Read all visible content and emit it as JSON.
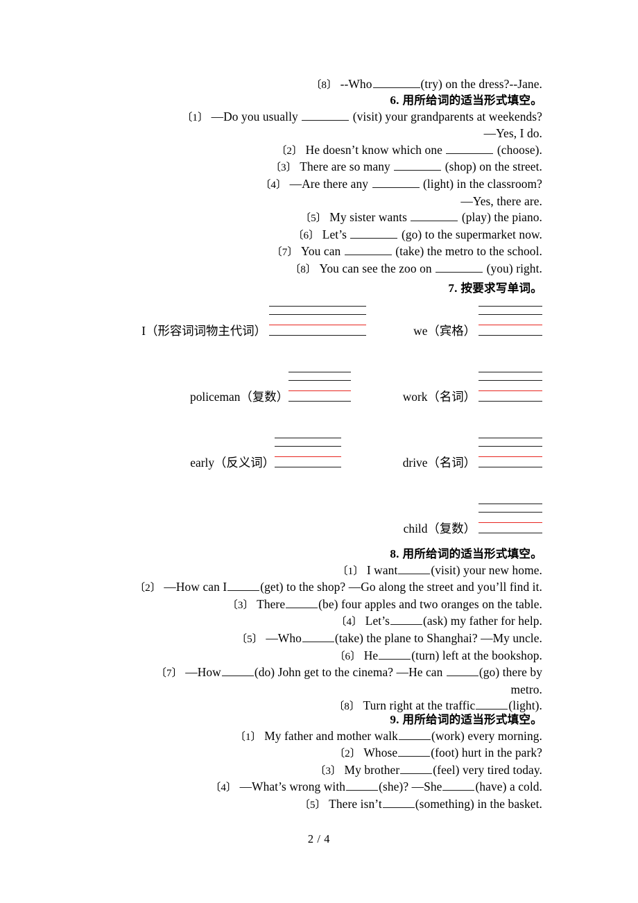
{
  "document": {
    "page_label": "2 / 4"
  },
  "exercises": [
    {
      "id": "q5-tail",
      "items": [
        {
          "num": "〔8〕",
          "before": "--Who",
          "blank": "w8",
          "after": "(try) on the dress?--Jane."
        }
      ]
    },
    {
      "id": "section-6",
      "heading_number": "6.",
      "heading_text": "用所给词的适当形式填空。",
      "lines": [
        {
          "num": "〔1〕",
          "before": "—Do you usually",
          "blank": "w8",
          "after": "(visit) your grandparents at weekends?"
        },
        {
          "num": "",
          "before": "",
          "blank": "",
          "after": "—Yes, I do."
        },
        {
          "num": "〔2〕",
          "before": "He doesn’t know which one",
          "blank": "w8",
          "after": "(choose)."
        },
        {
          "num": "〔3〕",
          "before": "There are so many",
          "blank": "w8",
          "after": "(shop) on the street."
        },
        {
          "num": "〔4〕",
          "before": "—Are there any",
          "blank": "w8",
          "after": "(light) in the classroom?"
        },
        {
          "num": "",
          "before": "",
          "blank": "",
          "after": "—Yes, there are."
        },
        {
          "num": "〔5〕",
          "before": "My sister wants",
          "blank": "w8",
          "after": "(play) the piano."
        },
        {
          "num": "〔6〕",
          "before": "Let’s",
          "blank": "w8",
          "after": "(go) to the supermarket now."
        },
        {
          "num": "〔7〕",
          "before": "You can",
          "blank": "w8",
          "after": "(take) the metro to the school."
        },
        {
          "num": "〔8〕",
          "before": "You can see the zoo on",
          "blank": "w8",
          "after": "(you) right."
        }
      ]
    },
    {
      "id": "section-7",
      "heading_number": "7.",
      "heading_text": "按要求写单词。",
      "word_rows": [
        {
          "left": "I（形容词词物主代词）",
          "right": "we（宾格）"
        },
        {
          "left": "policeman（复数）",
          "right": "work（名词）"
        },
        {
          "left": "early（反义词）",
          "right": "drive（名词）"
        },
        {
          "left": "",
          "right": "child（复数）"
        }
      ]
    },
    {
      "id": "section-8",
      "heading_number": "8.",
      "heading_text": "用所给词的适当形式填空。",
      "lines": [
        {
          "num": "〔1〕",
          "before": "I want",
          "blank": "w6",
          "after": "(visit) your new home."
        },
        {
          "num": "〔2〕",
          "before": "—How can I",
          "blank": "w6",
          "after": "(get) to the shop? —Go along the street and you’ll find it."
        },
        {
          "num": "〔3〕",
          "before": "There",
          "blank": "w6",
          "after": "(be) four apples and two oranges on the table."
        },
        {
          "num": "〔4〕",
          "before": "Let’s",
          "blank": "w6",
          "after": "(ask) my father for help."
        },
        {
          "num": "〔5〕",
          "before": "—Who",
          "blank": "w6",
          "after": "(take) the plane to Shanghai? —My uncle."
        },
        {
          "num": "〔6〕",
          "before": "He",
          "blank": "w6",
          "after": "(turn) left at the bookshop."
        },
        {
          "num": "〔7〕",
          "before": "—How",
          "blank": "w6",
          "after": "(do) John get to the cinema? —He can",
          "blank2": "w6",
          "after2": "(go) there by"
        },
        {
          "num": "",
          "before": "",
          "blank": "",
          "after": "metro."
        },
        {
          "num": "〔8〕",
          "before": "Turn right at the traffic",
          "blank": "w6",
          "after": "(light)."
        }
      ]
    },
    {
      "id": "section-9",
      "heading_number": "9.",
      "heading_text": "用所给词的适当形式填空。",
      "lines": [
        {
          "num": "〔1〕",
          "before": "My father and mother walk",
          "blank": "w6",
          "after": "(work) every morning."
        },
        {
          "num": "〔2〕",
          "before": "Whose",
          "blank": "w6",
          "after": "(foot) hurt in the park?"
        },
        {
          "num": "〔3〕",
          "before": "My brother",
          "blank": "w6",
          "after": "(feel) very tired today."
        },
        {
          "num": "〔4〕",
          "before": "—What’s wrong with",
          "blank": "w6",
          "after": "(she)? —She",
          "blank2": "w6",
          "after2": "(have) a cold."
        },
        {
          "num": "〔5〕",
          "before": "There isn’t",
          "blank": "w6",
          "after": "(something) in the basket."
        }
      ]
    }
  ],
  "colors": {
    "text": "#000000",
    "rule_black": "#1b1b1b",
    "rule_red": "#e8251f"
  }
}
